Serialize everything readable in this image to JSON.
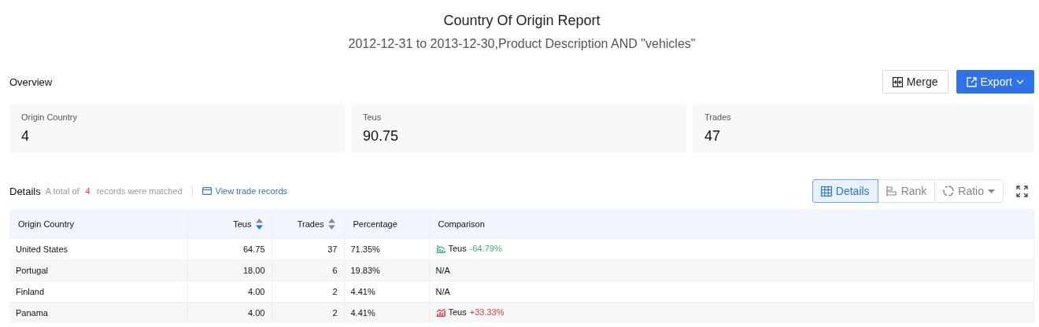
{
  "report": {
    "title": "Country Of Origin Report",
    "subtitle": "2012-12-31 to 2013-12-30,Product Description AND \"vehicles\""
  },
  "overview": {
    "heading": "Overview",
    "actions": [
      {
        "kind": "merge",
        "label": "Merge"
      },
      {
        "kind": "export",
        "label": "Export"
      }
    ],
    "cards": [
      {
        "label": "Origin Country",
        "value": "4"
      },
      {
        "label": "Teus",
        "value": "90.75"
      },
      {
        "label": "Trades",
        "value": "47"
      }
    ]
  },
  "details": {
    "heading": "Details",
    "summary_prefix": "A total of",
    "count": "4",
    "summary_suffix": "records were matched",
    "link": "View trade records",
    "views": [
      {
        "kind": "table",
        "label": "Details",
        "selected": true,
        "dropdown": false
      },
      {
        "kind": "rank",
        "label": "Rank",
        "selected": false,
        "dropdown": false
      },
      {
        "kind": "ratio",
        "label": "Ratio",
        "selected": false,
        "dropdown": true
      }
    ]
  },
  "table": {
    "columns": [
      {
        "label": "Origin Country",
        "numeric": false,
        "sortable": false,
        "sorted": false
      },
      {
        "label": "Teus",
        "numeric": true,
        "sortable": true,
        "sorted": true
      },
      {
        "label": "Trades",
        "numeric": true,
        "sortable": true,
        "sorted": false
      },
      {
        "label": "Percentage",
        "numeric": false,
        "sortable": false,
        "sorted": false
      },
      {
        "label": "Comparison",
        "numeric": false,
        "sortable": false,
        "sorted": false
      }
    ],
    "rows": [
      {
        "country": "United States",
        "teus": "64.75",
        "trades": "37",
        "percentage": "71.35%",
        "comparison": {
          "kind": "trend",
          "rising": false,
          "label": "Teus",
          "change": "-64.79%"
        }
      },
      {
        "country": "Portugal",
        "teus": "18.00",
        "trades": "6",
        "percentage": "19.83%",
        "comparison": {
          "kind": "text",
          "text": "N/A"
        }
      },
      {
        "country": "Finland",
        "teus": "4.00",
        "trades": "2",
        "percentage": "4.41%",
        "comparison": {
          "kind": "text",
          "text": "N/A"
        }
      },
      {
        "country": "Panama",
        "teus": "4.00",
        "trades": "2",
        "percentage": "4.41%",
        "comparison": {
          "kind": "trend",
          "rising": true,
          "label": "Teus",
          "change": "+33.33%"
        }
      }
    ]
  }
}
